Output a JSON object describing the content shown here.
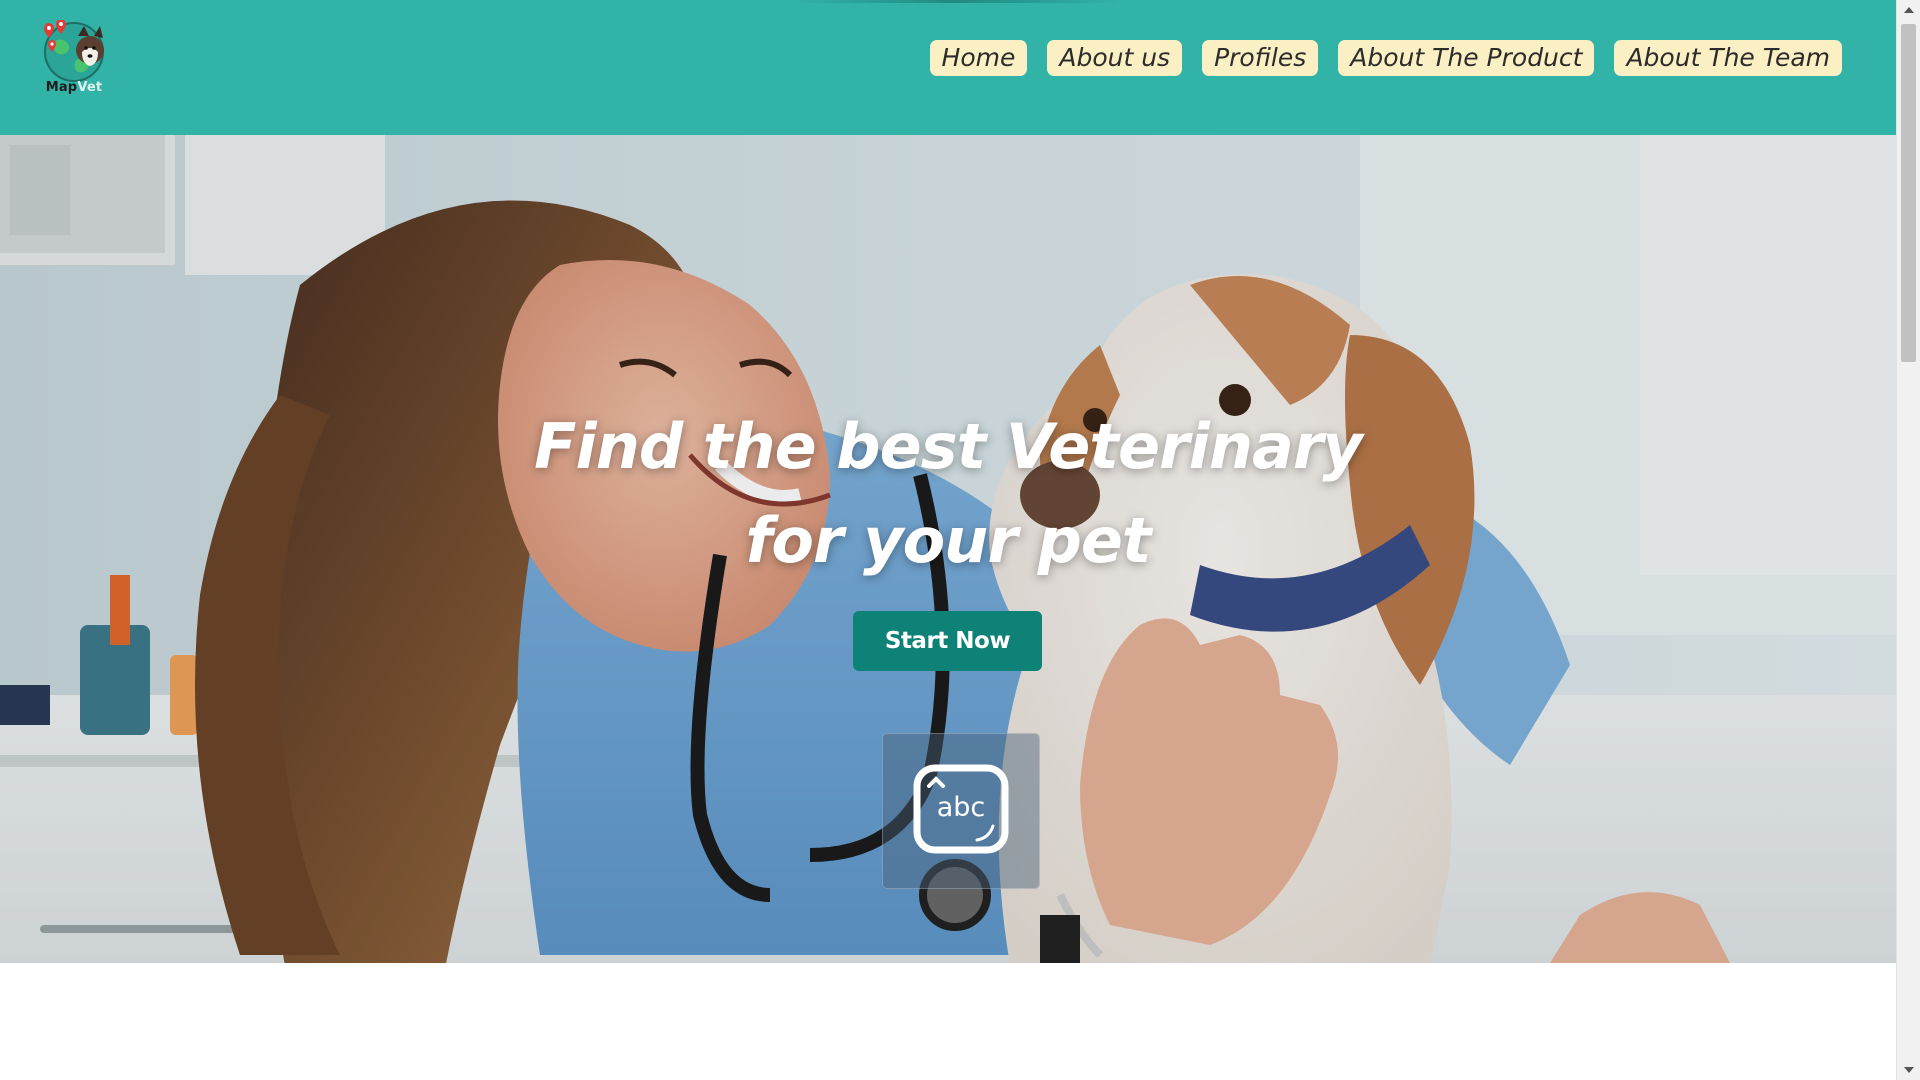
{
  "brand": {
    "name_part1": "Map",
    "name_part2": "Vet"
  },
  "nav": {
    "items": [
      {
        "label": "Home"
      },
      {
        "label": "About us"
      },
      {
        "label": "Profiles"
      },
      {
        "label": "About The Product"
      },
      {
        "label": "About The Team"
      }
    ]
  },
  "hero": {
    "title_line1": "Find the best Veterinary",
    "title_line2": "for your pet",
    "cta_label": "Start Now",
    "keyboard_widget_label": "abc"
  },
  "colors": {
    "header_bg": "#32b3a8",
    "nav_pill_bg": "#fbefc4",
    "cta_bg": "#0e8276"
  },
  "icons": {
    "logo": "map-pin-dog-globe-logo",
    "keyboard": "keyboard-icon"
  }
}
